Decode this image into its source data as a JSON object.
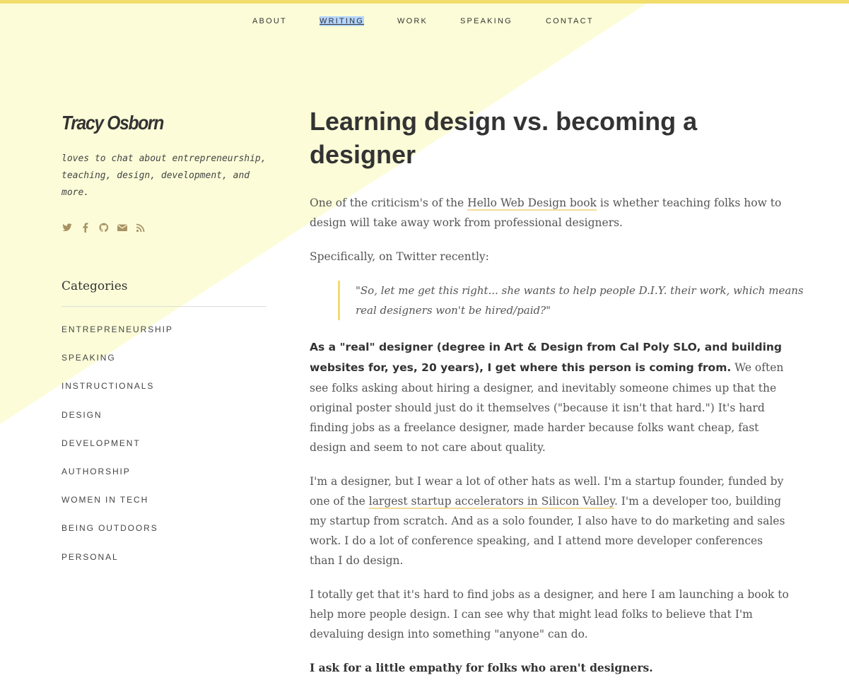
{
  "colors": {
    "accent": "#f2dc6b",
    "background_stripe": "#fcfcd9",
    "selection_highlight": "#b4d5fe",
    "social_icons": "#a89264"
  },
  "nav": {
    "items": [
      "ABOUT",
      "WRITING",
      "WORK",
      "SPEAKING",
      "CONTACT"
    ],
    "active": "WRITING"
  },
  "sidebar": {
    "site_name": "Tracy Osborn",
    "tagline": "loves to chat about entrepreneurship, teaching, design, development, and more.",
    "social_icons": [
      "twitter-icon",
      "facebook-icon",
      "github-icon",
      "email-icon",
      "rss-icon"
    ],
    "categories_title": "Categories",
    "categories": [
      "ENTREPRENEURSHIP",
      "SPEAKING",
      "INSTRUCTIONALS",
      "DESIGN",
      "DEVELOPMENT",
      "AUTHORSHIP",
      "WOMEN IN TECH",
      "BEING OUTDOORS",
      "PERSONAL"
    ]
  },
  "post": {
    "title": "Learning design vs. becoming a designer",
    "p1_before": "One of the criticism's of the ",
    "p1_link": "Hello Web Design book",
    "p1_after": " is whether teaching folks how to design will take away work from professional designers.",
    "p2": "Specifically, on Twitter recently:",
    "quote": "\"So, let me get this right... she wants to help people D.I.Y. their work, which means real designers won't be hired/paid?\"",
    "p3_strong": "As a \"real\" designer (degree in Art & Design from Cal Poly SLO, and building websites for, yes, 20 years), I get where this person is coming from.",
    "p3_rest": " We often see folks asking about hiring a designer, and inevitably someone chimes up that the original poster should just do it themselves (\"because it isn't that hard.\") It's hard finding jobs as a freelance designer, made harder because folks want cheap, fast design and seem to not care about quality.",
    "p4_before": "I'm a designer, but I wear a lot of other hats as well. I'm a startup founder, funded by one of the ",
    "p4_link": "largest startup accelerators in Silicon Valley",
    "p4_after": ". I'm a developer too, building my startup from scratch. And as a solo founder, I also have to do marketing and sales work. I do a lot of conference speaking, and I attend more developer conferences than I do design.",
    "p5": "I totally get that it's hard to find jobs as a designer, and here I am launching a book to help more people design. I can see why that might lead folks to believe that I'm devaluing design into something \"anyone\" can do.",
    "p6_bold": "I ask for a little empathy for folks who aren't designers."
  }
}
